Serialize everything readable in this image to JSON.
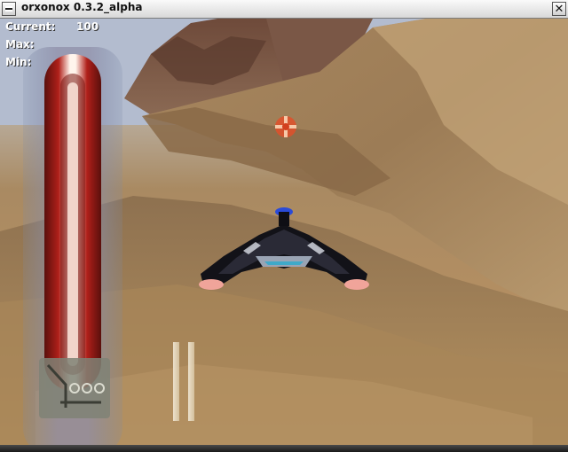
{
  "window": {
    "title": "orxonox 0.3.2_alpha",
    "close_glyph": "✕"
  },
  "hud": {
    "current_label": "Current:",
    "current_value": "100",
    "max_label": "Max:",
    "min_label": "Min:"
  },
  "icons": {
    "window_menu": "window-menu-icon",
    "close": "close-icon",
    "crosshair": "crosshair-icon",
    "ship": "player-ship",
    "weapon": "weapon-slot-icon"
  },
  "colors": {
    "sky": "#a9b4cf",
    "terrain": "#b58f62",
    "energy_core": "#b0201a",
    "crosshair": "#e0502a",
    "ship_body": "#121218",
    "ship_accent": "#2a4bd8"
  }
}
